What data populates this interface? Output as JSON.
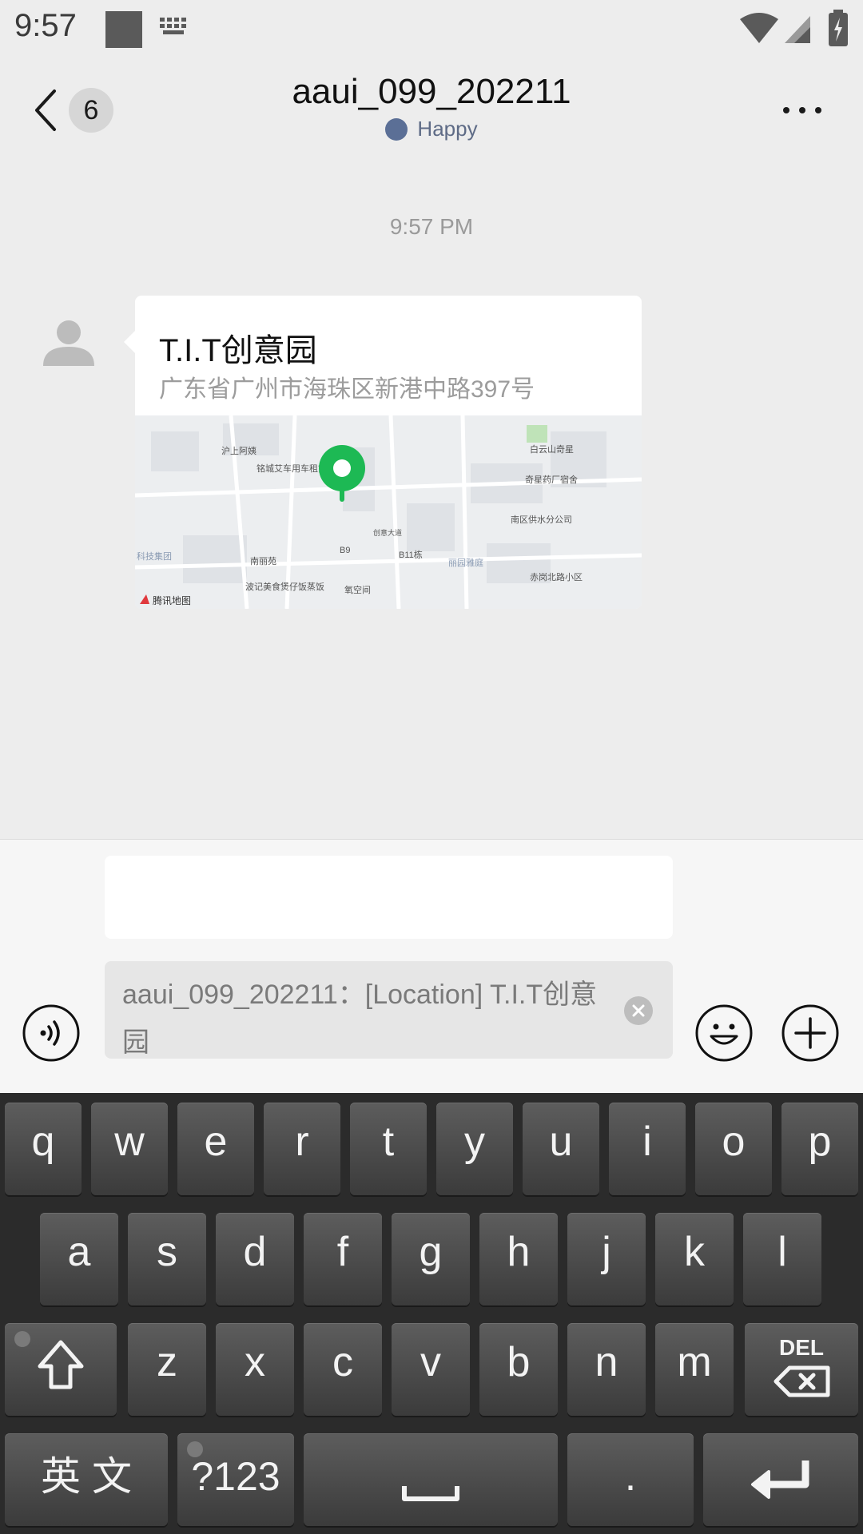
{
  "status_bar": {
    "time": "9:57"
  },
  "header": {
    "back_badge": "6",
    "title": "aaui_099_202211",
    "status_text": "Happy"
  },
  "chat": {
    "timestamp": "9:57 PM",
    "message": {
      "location_name": "T.I.T创意园",
      "location_address": "广东省广州市海珠区新港中路397号",
      "map": {
        "provider_label": "腾讯地图",
        "poi_labels": [
          "沪上阿姨",
          "铭城艾车用车租赁公司",
          "白云山奇星",
          "奇星药厂宿舍",
          "南区供水分公司",
          "南丽苑",
          "B9",
          "B11栋",
          "科技集团",
          "波记美食煲仔饭蒸饭",
          "氧空间",
          "赤岗北路小区",
          "丽园雅庭",
          "创意大道"
        ],
        "pin_color": "#1db954"
      }
    }
  },
  "input": {
    "quote_text": "aaui_099_202211：[Location] T.I.T创意园"
  },
  "keyboard": {
    "row1": [
      "q",
      "w",
      "e",
      "r",
      "t",
      "y",
      "u",
      "i",
      "o",
      "p"
    ],
    "row2": [
      "a",
      "s",
      "d",
      "f",
      "g",
      "h",
      "j",
      "k",
      "l"
    ],
    "row3": [
      "z",
      "x",
      "c",
      "v",
      "b",
      "n",
      "m"
    ],
    "lang_label": "英 文",
    "sym_label": "?123",
    "del_label": "DEL",
    "period_label": "."
  },
  "colors": {
    "background": "#ededed",
    "bubble": "#ffffff",
    "keyboard": "#2b2b2b",
    "accent_pin": "#1db954"
  }
}
